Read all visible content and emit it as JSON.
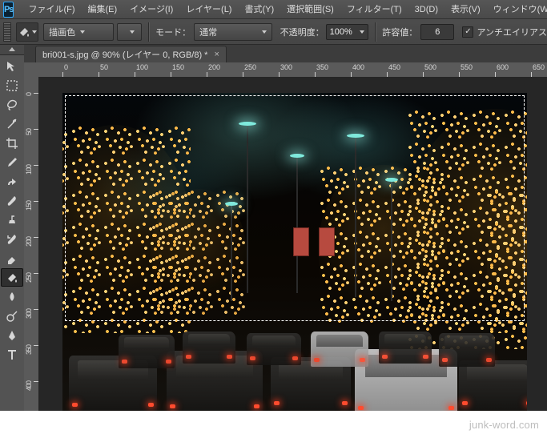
{
  "app": {
    "logo": "Ps"
  },
  "menu": {
    "items": [
      "ファイル(F)",
      "編集(E)",
      "イメージ(I)",
      "レイヤー(L)",
      "書式(Y)",
      "選択範囲(S)",
      "フィルター(T)",
      "3D(D)",
      "表示(V)",
      "ウィンドウ(W"
    ]
  },
  "options": {
    "fill_label": "描画色",
    "mode_label": "モード：",
    "mode_value": "通常",
    "opacity_label": "不透明度：",
    "opacity_value": "100%",
    "tolerance_label": "許容値：",
    "tolerance_value": "6",
    "antialias_label": "アンチエイリアス"
  },
  "document": {
    "tab_title": "bri001-s.jpg @ 90% (レイヤー 0, RGB/8) *"
  },
  "rulers": {
    "h": [
      "0",
      "50",
      "100",
      "150",
      "200",
      "250",
      "300",
      "350",
      "400",
      "450",
      "500",
      "550",
      "600",
      "650"
    ],
    "v": [
      "0",
      "50",
      "100",
      "150",
      "200",
      "250",
      "300",
      "350",
      "400"
    ]
  },
  "tools": [
    {
      "n": "move-tool"
    },
    {
      "n": "marquee-tool"
    },
    {
      "n": "lasso-tool"
    },
    {
      "n": "magic-wand-tool"
    },
    {
      "n": "crop-tool"
    },
    {
      "n": "eyedropper-tool"
    },
    {
      "n": "spot-heal-tool"
    },
    {
      "n": "brush-tool"
    },
    {
      "n": "clone-stamp-tool"
    },
    {
      "n": "history-brush-tool"
    },
    {
      "n": "eraser-tool"
    },
    {
      "n": "paint-bucket-tool",
      "sel": true
    },
    {
      "n": "blur-tool"
    },
    {
      "n": "dodge-tool"
    },
    {
      "n": "pen-tool"
    },
    {
      "n": "type-tool"
    }
  ],
  "watermark": "junk-word.com"
}
